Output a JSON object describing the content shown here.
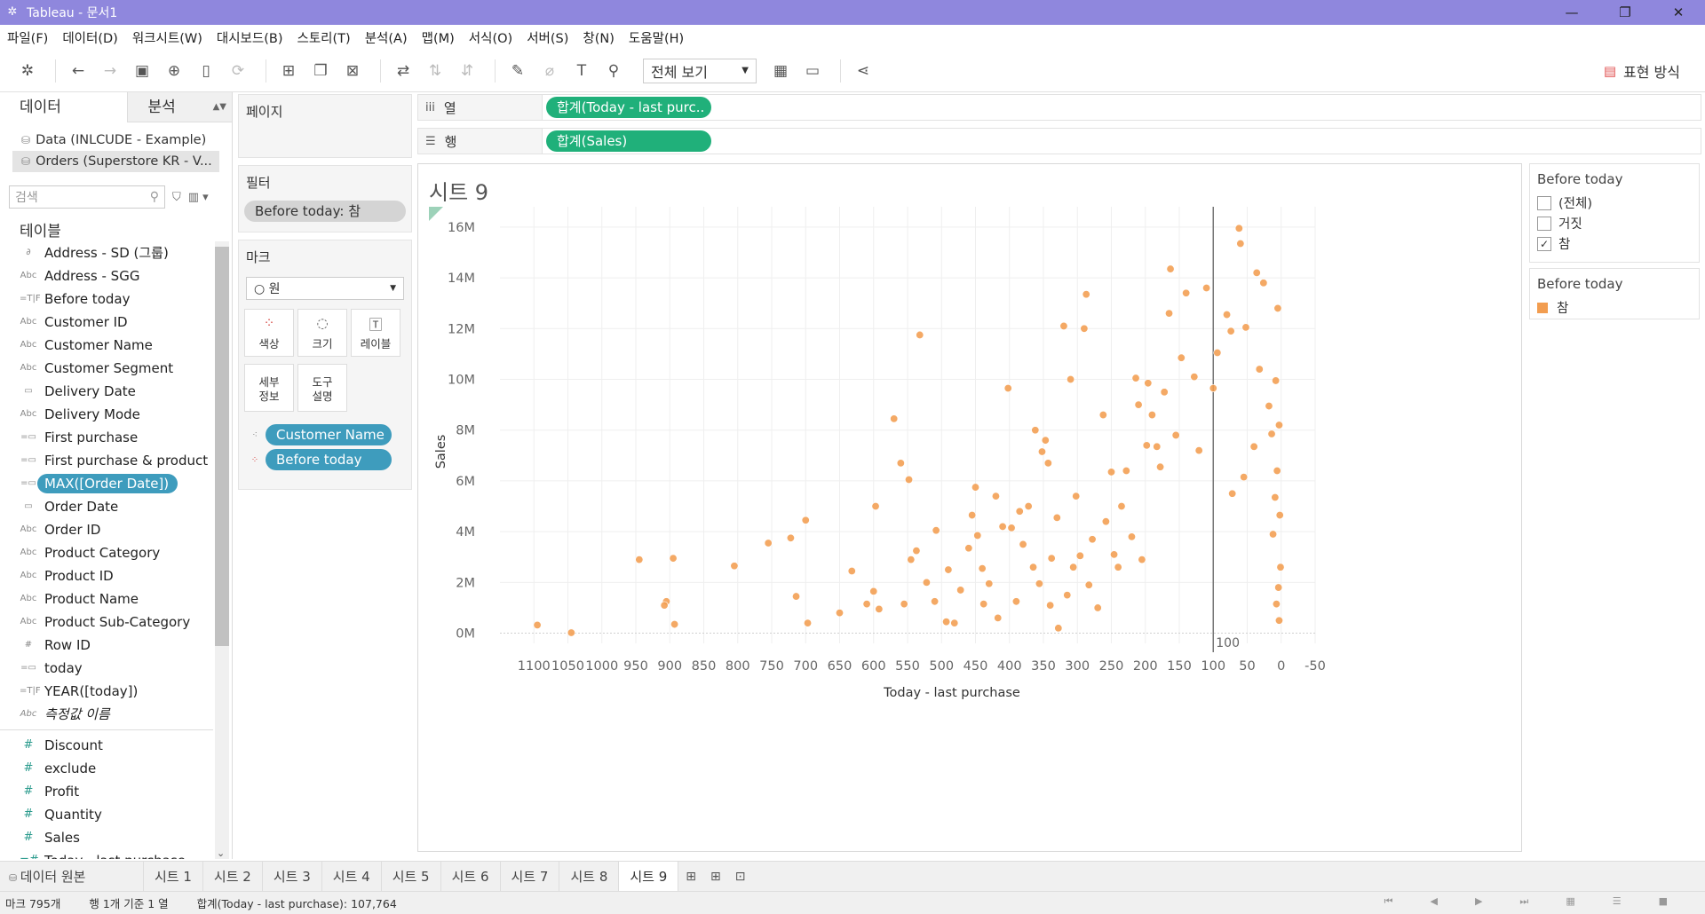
{
  "app_title": "Tableau - 문서1",
  "window_controls": [
    "—",
    "❐",
    "✕"
  ],
  "menu": [
    "파일(F)",
    "데이터(D)",
    "워크시트(W)",
    "대시보드(B)",
    "스토리(T)",
    "분석(A)",
    "맵(M)",
    "서식(O)",
    "서버(S)",
    "창(N)",
    "도움말(H)"
  ],
  "toolbar": {
    "fit_label": "전체 보기",
    "show_me": "표현 방식"
  },
  "data_pane": {
    "tab_data": "데이터",
    "tab_analysis": "분석",
    "sources": [
      "Data (INLCUDE - Example)",
      "Orders (Superstore KR - V..."
    ],
    "search_placeholder": "검색",
    "tables_heading": "테이블",
    "dimensions": [
      {
        "icon": "link",
        "label": "Address - SD (그룹)"
      },
      {
        "icon": "Abc",
        "label": "Address - SGG"
      },
      {
        "icon": "=T|F",
        "label": "Before today"
      },
      {
        "icon": "Abc",
        "label": "Customer ID"
      },
      {
        "icon": "Abc",
        "label": "Customer Name"
      },
      {
        "icon": "Abc",
        "label": "Customer Segment"
      },
      {
        "icon": "date",
        "label": "Delivery Date"
      },
      {
        "icon": "Abc",
        "label": "Delivery Mode"
      },
      {
        "icon": "=date",
        "label": "First purchase"
      },
      {
        "icon": "=date",
        "label": "First purchase & product"
      },
      {
        "icon": "=date",
        "label": "MAX([Order Date])"
      },
      {
        "icon": "date",
        "label": "Order Date"
      },
      {
        "icon": "Abc",
        "label": "Order ID"
      },
      {
        "icon": "Abc",
        "label": "Product Category"
      },
      {
        "icon": "Abc",
        "label": "Product ID"
      },
      {
        "icon": "Abc",
        "label": "Product Name"
      },
      {
        "icon": "Abc",
        "label": "Product Sub-Category"
      },
      {
        "icon": "#",
        "label": "Row ID"
      },
      {
        "icon": "=date",
        "label": "today"
      },
      {
        "icon": "=T|F",
        "label": "YEAR([today])"
      },
      {
        "icon": "Abc",
        "label": "측정값 이름"
      }
    ],
    "measures": [
      {
        "icon": "#",
        "label": "Discount"
      },
      {
        "icon": "#",
        "label": "exclude"
      },
      {
        "icon": "#",
        "label": "Profit"
      },
      {
        "icon": "#",
        "label": "Quantity"
      },
      {
        "icon": "#",
        "label": "Sales"
      },
      {
        "icon": "=#",
        "label": "Today - last purchase"
      }
    ]
  },
  "pages_label": "페이지",
  "filters": {
    "label": "필터",
    "pill": "Before today: 참"
  },
  "marks": {
    "label": "마크",
    "type": "원",
    "buttons": [
      "색상",
      "크기",
      "레이블"
    ],
    "buttons2": [
      "세부\n정보",
      "도구\n설명"
    ],
    "detail_pill": "Customer Name",
    "color_pill": "Before today"
  },
  "columns": {
    "label": "열",
    "pill": "합계(Today - last purc.."
  },
  "rows": {
    "label": "행",
    "pill": "합계(Sales)"
  },
  "sheet_title": "시트 9",
  "legend_filter": {
    "title": "Before today",
    "items": [
      {
        "label": "(전체)",
        "checked": false
      },
      {
        "label": "거짓",
        "checked": false
      },
      {
        "label": "참",
        "checked": true
      }
    ]
  },
  "legend_color": {
    "title": "Before today",
    "items": [
      {
        "label": "참",
        "color": "#f29d50"
      }
    ]
  },
  "sheet_tabs": {
    "datasource": "데이터 원본",
    "tabs": [
      "시트 1",
      "시트 2",
      "시트 3",
      "시트 4",
      "시트 5",
      "시트 6",
      "시트 7",
      "시트 8",
      "시트 9"
    ],
    "active": "시트 9"
  },
  "status": {
    "marks": "마크 795개",
    "rows_cols": "행 1개 기준 1 열",
    "sum": "합계(Today - last purchase): 107,764"
  },
  "chart_data": {
    "type": "scatter",
    "xlabel": "Today - last purchase",
    "ylabel": "Sales",
    "x_reversed": true,
    "xlim": [
      -50,
      1150
    ],
    "ylim": [
      -400000,
      16800000
    ],
    "x_ticks": [
      1100,
      1050,
      1000,
      950,
      900,
      850,
      800,
      750,
      700,
      650,
      600,
      550,
      500,
      450,
      400,
      350,
      300,
      250,
      200,
      150,
      100,
      50,
      0,
      -50
    ],
    "y_ticks": [
      0,
      2000000,
      4000000,
      6000000,
      8000000,
      10000000,
      12000000,
      14000000,
      16000000
    ],
    "y_tick_labels": [
      "0M",
      "2M",
      "4M",
      "6M",
      "8M",
      "10M",
      "12M",
      "14M",
      "16M"
    ],
    "reference_line": {
      "x": 100,
      "label": "100"
    },
    "color": "#f29d50",
    "mark_count": 795,
    "points": [
      [
        1095,
        320000
      ],
      [
        1045,
        20000
      ],
      [
        945,
        2900000
      ],
      [
        895,
        2950000
      ],
      [
        905,
        1250000
      ],
      [
        908,
        1100000
      ],
      [
        893,
        350000
      ],
      [
        805,
        2650000
      ],
      [
        755,
        3550000
      ],
      [
        722,
        3750000
      ],
      [
        714,
        1450000
      ],
      [
        700,
        4450000
      ],
      [
        697,
        400000
      ],
      [
        632,
        2450000
      ],
      [
        650,
        800000
      ],
      [
        610,
        1150000
      ],
      [
        597,
        5000000
      ],
      [
        600,
        1650000
      ],
      [
        592,
        950000
      ],
      [
        570,
        8450000
      ],
      [
        560,
        6700000
      ],
      [
        548,
        6050000
      ],
      [
        555,
        1150000
      ],
      [
        545,
        2900000
      ],
      [
        537,
        3250000
      ],
      [
        532,
        11750000
      ],
      [
        522,
        2000000
      ],
      [
        510,
        1250000
      ],
      [
        508,
        4050000
      ],
      [
        493,
        450000
      ],
      [
        490,
        2500000
      ],
      [
        481,
        400000
      ],
      [
        472,
        1700000
      ],
      [
        460,
        3350000
      ],
      [
        450,
        5750000
      ],
      [
        455,
        4650000
      ],
      [
        447,
        3850000
      ],
      [
        440,
        2550000
      ],
      [
        438,
        1150000
      ],
      [
        430,
        1950000
      ],
      [
        420,
        5400000
      ],
      [
        417,
        600000
      ],
      [
        410,
        4200000
      ],
      [
        402,
        9650000
      ],
      [
        397,
        4150000
      ],
      [
        390,
        1250000
      ],
      [
        385,
        4800000
      ],
      [
        380,
        3500000
      ],
      [
        372,
        5000000
      ],
      [
        365,
        2600000
      ],
      [
        362,
        8000000
      ],
      [
        356,
        1950000
      ],
      [
        352,
        7150000
      ],
      [
        347,
        7600000
      ],
      [
        343,
        6700000
      ],
      [
        340,
        1100000
      ],
      [
        338,
        2950000
      ],
      [
        330,
        4550000
      ],
      [
        328,
        200000
      ],
      [
        320,
        12100000
      ],
      [
        315,
        1500000
      ],
      [
        310,
        10000000
      ],
      [
        306,
        2600000
      ],
      [
        302,
        5400000
      ],
      [
        296,
        3050000
      ],
      [
        290,
        12000000
      ],
      [
        287,
        13350000
      ],
      [
        283,
        1900000
      ],
      [
        278,
        3700000
      ],
      [
        270,
        1000000
      ],
      [
        262,
        8600000
      ],
      [
        258,
        4400000
      ],
      [
        250,
        6350000
      ],
      [
        246,
        3100000
      ],
      [
        240,
        2600000
      ],
      [
        235,
        5000000
      ],
      [
        228,
        6400000
      ],
      [
        220,
        3800000
      ],
      [
        214,
        10050000
      ],
      [
        210,
        9000000
      ],
      [
        205,
        2900000
      ],
      [
        198,
        7400000
      ],
      [
        196,
        9850000
      ],
      [
        190,
        8600000
      ],
      [
        183,
        7350000
      ],
      [
        178,
        6550000
      ],
      [
        172,
        9500000
      ],
      [
        163,
        14350000
      ],
      [
        165,
        12600000
      ],
      [
        155,
        7800000
      ],
      [
        147,
        10850000
      ],
      [
        140,
        13400000
      ],
      [
        128,
        10100000
      ],
      [
        121,
        7200000
      ],
      [
        110,
        13600000
      ],
      [
        100,
        9650000
      ],
      [
        94,
        11050000
      ],
      [
        80,
        12550000
      ],
      [
        74,
        11900000
      ],
      [
        62,
        15950000
      ],
      [
        60,
        15350000
      ],
      [
        36,
        14200000
      ],
      [
        26,
        13800000
      ],
      [
        5,
        12800000
      ],
      [
        52,
        12050000
      ],
      [
        32,
        10400000
      ],
      [
        8,
        9950000
      ],
      [
        3,
        8200000
      ],
      [
        14,
        7850000
      ],
      [
        6,
        6400000
      ],
      [
        9,
        5350000
      ],
      [
        2,
        4650000
      ],
      [
        12,
        3900000
      ],
      [
        1,
        2600000
      ],
      [
        4,
        1800000
      ],
      [
        7,
        1150000
      ],
      [
        3,
        500000
      ],
      [
        18,
        8950000
      ],
      [
        40,
        7350000
      ],
      [
        55,
        6150000
      ],
      [
        72,
        5500000
      ]
    ]
  }
}
